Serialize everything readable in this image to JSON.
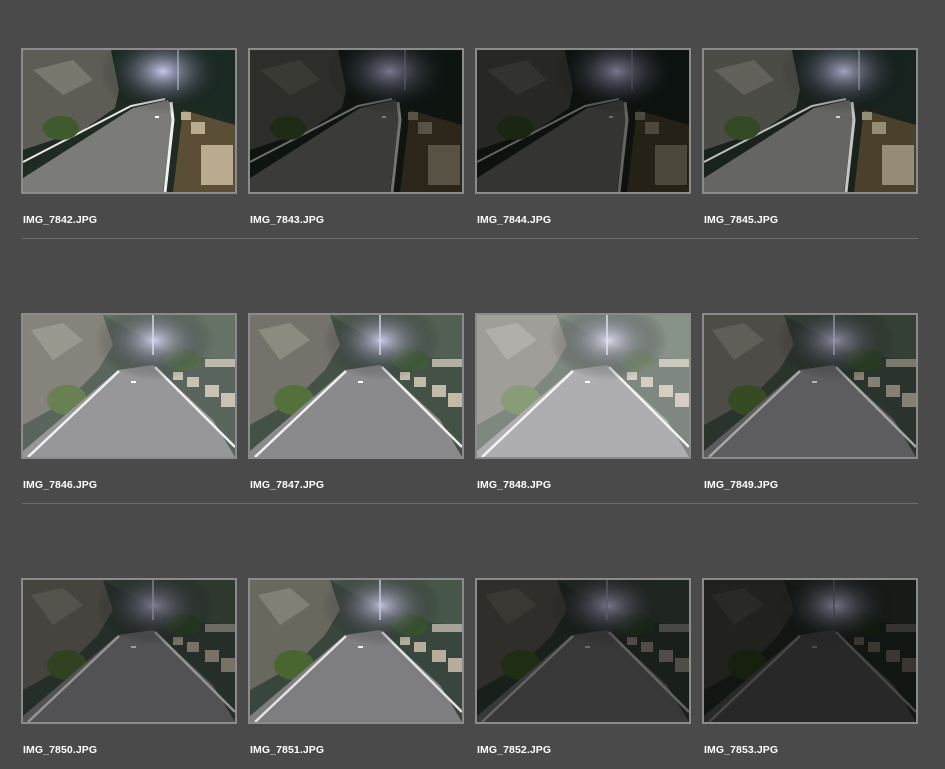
{
  "window": {
    "title": ""
  },
  "rows": [
    {
      "items": [
        {
          "filename": "IMG_7842.JPG",
          "brightness": 1.0
        },
        {
          "filename": "IMG_7843.JPG",
          "brightness": 0.48
        },
        {
          "filename": "IMG_7844.JPG",
          "brightness": 0.42
        },
        {
          "filename": "IMG_7845.JPG",
          "brightness": 0.82
        }
      ]
    },
    {
      "items": [
        {
          "filename": "IMG_7846.JPG",
          "brightness": 1.2
        },
        {
          "filename": "IMG_7847.JPG",
          "brightness": 1.05
        },
        {
          "filename": "IMG_7848.JPG",
          "brightness": 1.45
        },
        {
          "filename": "IMG_7849.JPG",
          "brightness": 0.7
        }
      ]
    },
    {
      "items": [
        {
          "filename": "IMG_7850.JPG",
          "brightness": 0.62
        },
        {
          "filename": "IMG_7851.JPG",
          "brightness": 0.95
        },
        {
          "filename": "IMG_7852.JPG",
          "brightness": 0.42
        },
        {
          "filename": "IMG_7853.JPG",
          "brightness": 0.3
        }
      ]
    }
  ],
  "colors": {
    "background": "#4a4a4a",
    "thumb_border": "#8b8b8b",
    "divider": "#6d6d6d",
    "label": "#ffffff"
  }
}
